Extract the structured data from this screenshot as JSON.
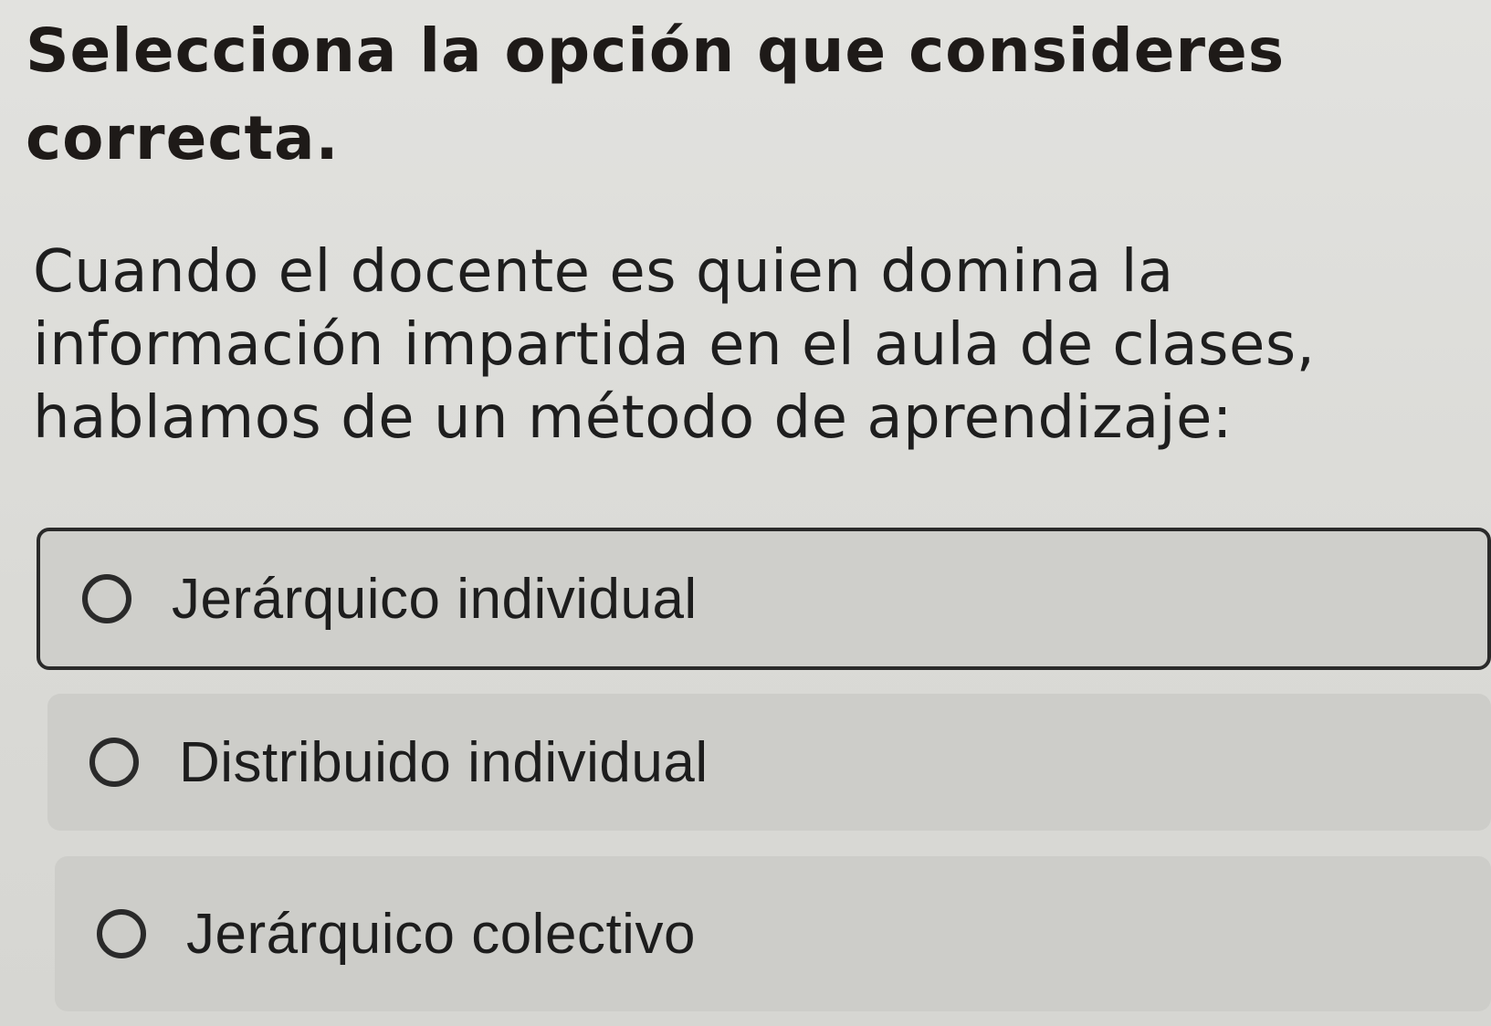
{
  "instruction": "Selecciona la opción que consideres correcta.",
  "question": "Cuando el docente es quien domina la información impartida en el aula de clases, hablamos de un método de aprendizaje:",
  "options": [
    {
      "label": "Jerárquico individual",
      "selected": true
    },
    {
      "label": "Distribuido individual",
      "selected": false
    },
    {
      "label": "Jerárquico colectivo",
      "selected": false
    }
  ]
}
